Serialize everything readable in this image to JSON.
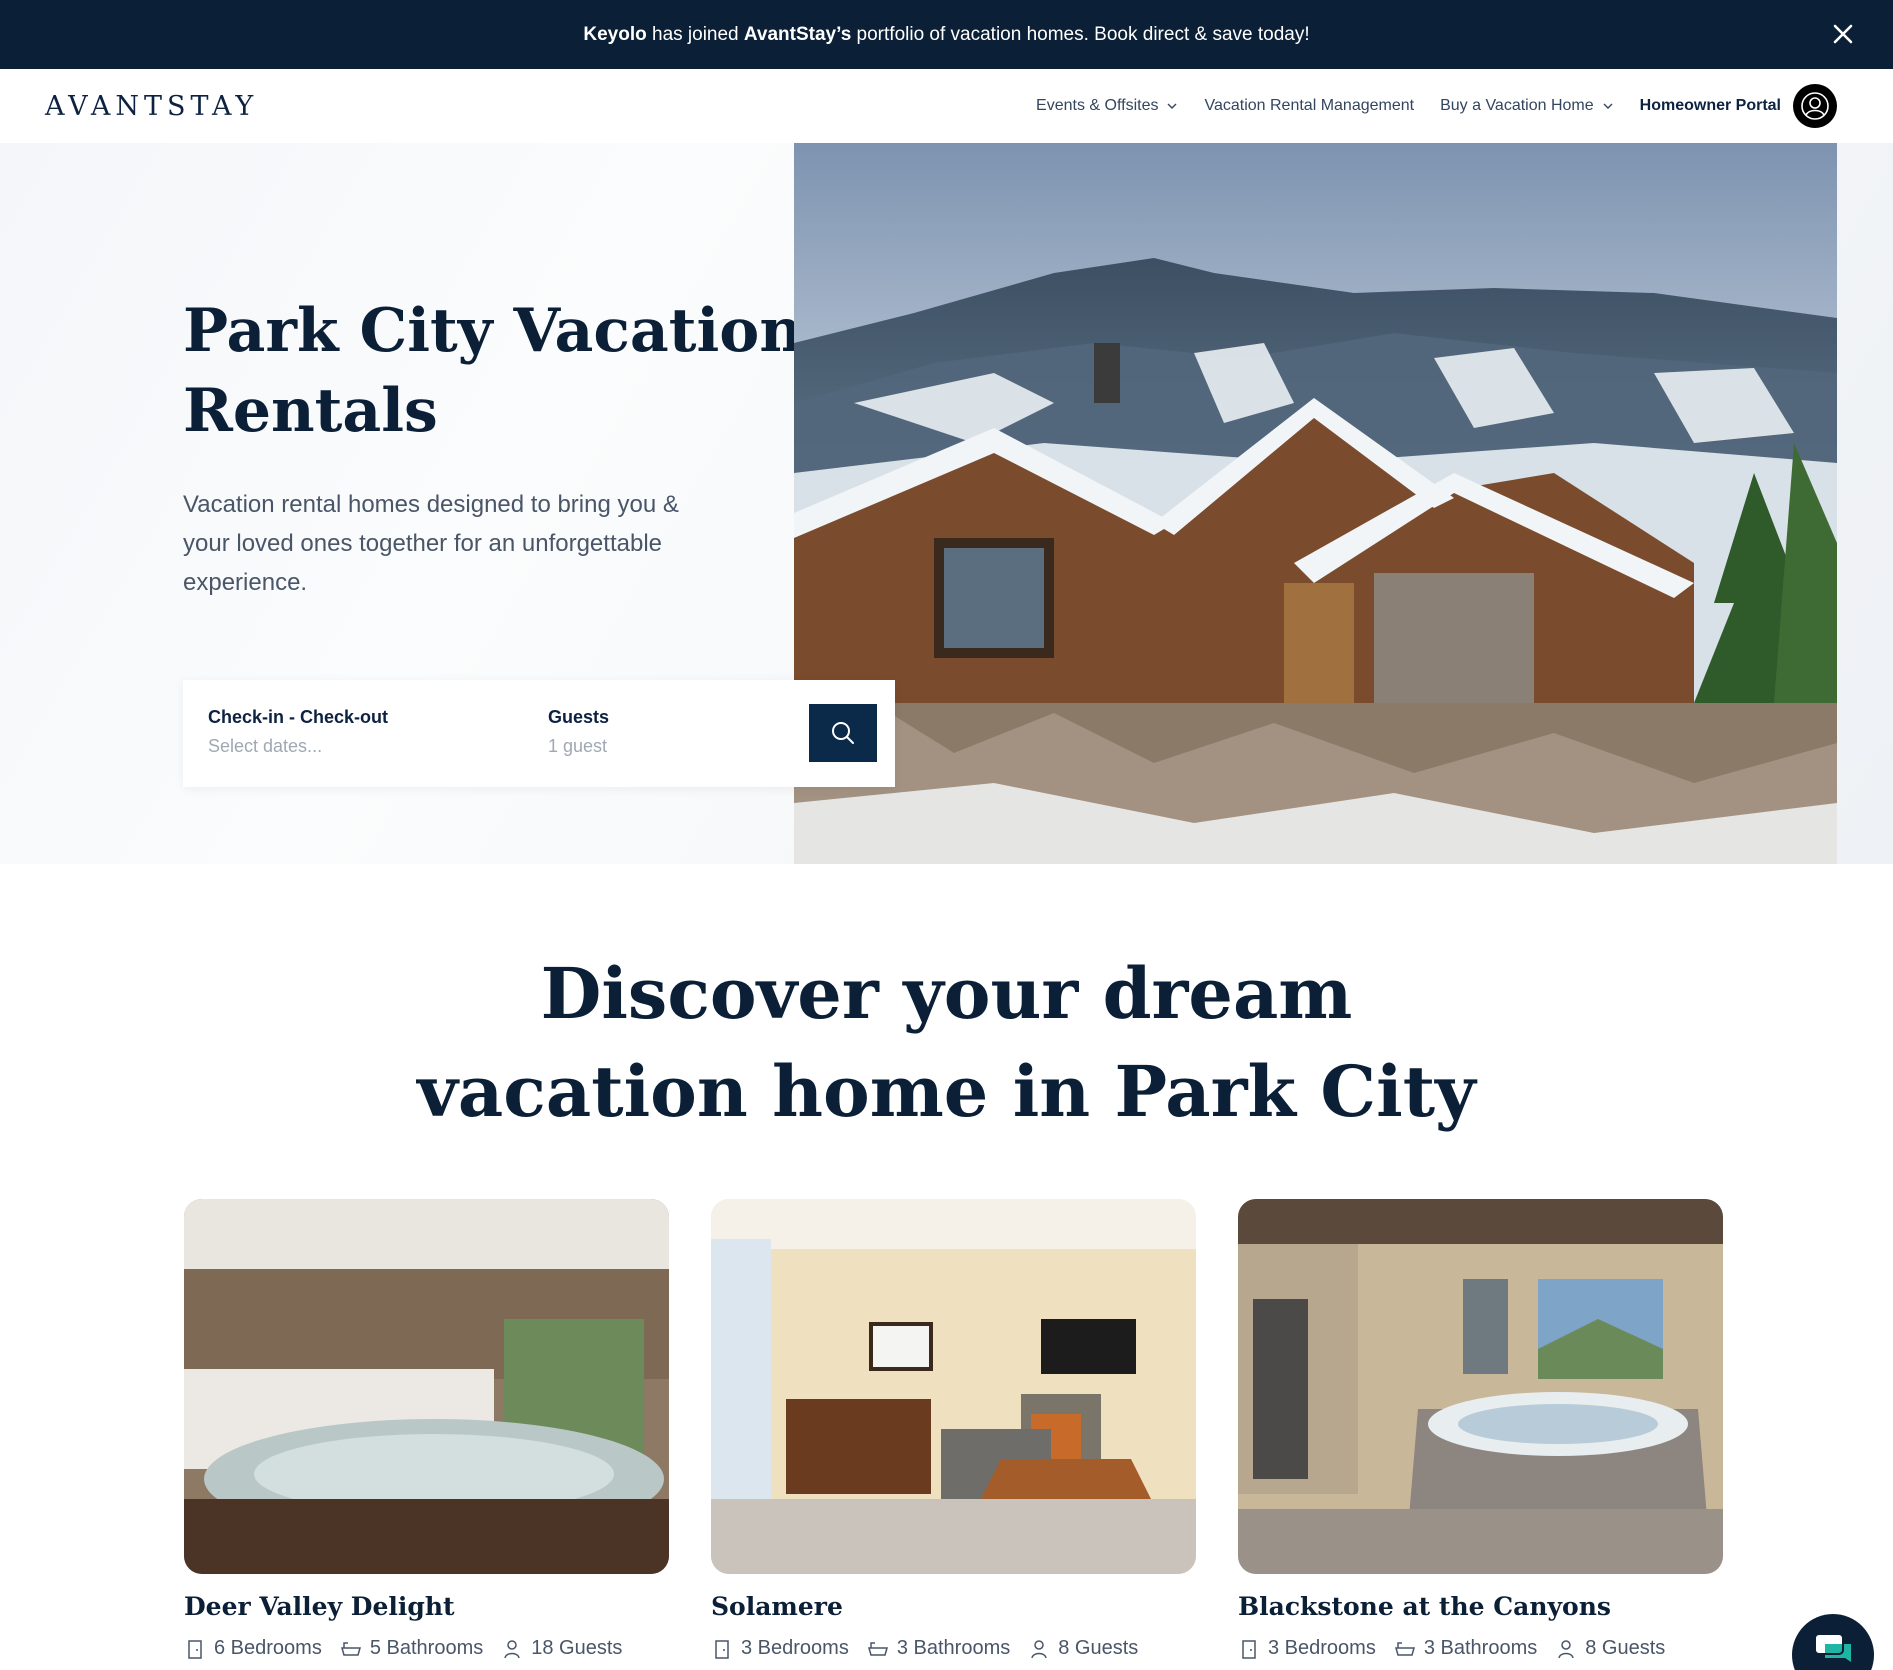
{
  "announcement": {
    "brand1": "Keyolo",
    "text1": " has joined ",
    "brand2": "AvantStay’s",
    "text2": " portfolio of vacation homes. Book direct & save today!",
    "close_icon": "close-icon"
  },
  "nav": {
    "logo": "AVANTSTAY",
    "links": [
      {
        "label": "Events & Offsites",
        "has_dropdown": true
      },
      {
        "label": "Vacation Rental Management",
        "has_dropdown": false
      },
      {
        "label": "Buy a Vacation Home",
        "has_dropdown": true
      },
      {
        "label": "Homeowner Portal",
        "has_dropdown": false
      }
    ],
    "account_icon": "user-icon"
  },
  "hero": {
    "title": "Park City Vacation Rentals",
    "subtitle": "Vacation rental homes designed to bring you & your loved ones together for an unforgettable experience.",
    "search": {
      "dates_label": "Check-in - Check-out",
      "dates_placeholder": "Select dates...",
      "guests_label": "Guests",
      "guests_value": "1 guest",
      "search_icon": "search-icon"
    }
  },
  "discover": {
    "title_line1": "Discover your dream",
    "title_line2": "vacation home in Park City"
  },
  "listings": [
    {
      "name": "Deer Valley Delight",
      "bedrooms": "6 Bedrooms",
      "bathrooms": "5 Bathrooms",
      "guests": "18 Guests"
    },
    {
      "name": "Solamere",
      "bedrooms": "3 Bedrooms",
      "bathrooms": "3 Bathrooms",
      "guests": "8 Guests"
    },
    {
      "name": "Blackstone at the Canyons",
      "bedrooms": "3 Bedrooms",
      "bathrooms": "3 Bathrooms",
      "guests": "8 Guests"
    }
  ],
  "colors": {
    "navy": "#0b1f36",
    "button": "#0b2a4a",
    "text_muted": "#4a5668"
  }
}
